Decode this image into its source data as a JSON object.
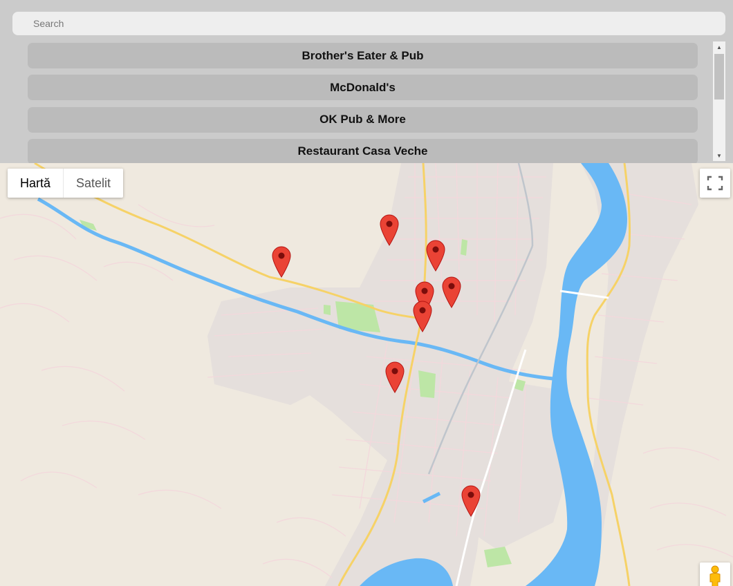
{
  "search": {
    "placeholder": "Search"
  },
  "restaurants": [
    {
      "label": "Brother's Eater & Pub"
    },
    {
      "label": "McDonald's"
    },
    {
      "label": "OK Pub & More"
    },
    {
      "label": "Restaurant Casa Veche"
    }
  ],
  "map_controls": {
    "map_label": "Hartă",
    "satellite_label": "Satelit"
  },
  "icons": {
    "fullscreen": "fullscreen-icon",
    "pegman": "pegman-icon",
    "marker": "map-marker-icon"
  },
  "colors": {
    "water": "#69b8f5",
    "land": "#efe9df",
    "urban": "#e6e1de",
    "park": "#b8e6a2",
    "road_major": "#f6d267",
    "marker": "#ea4335"
  }
}
